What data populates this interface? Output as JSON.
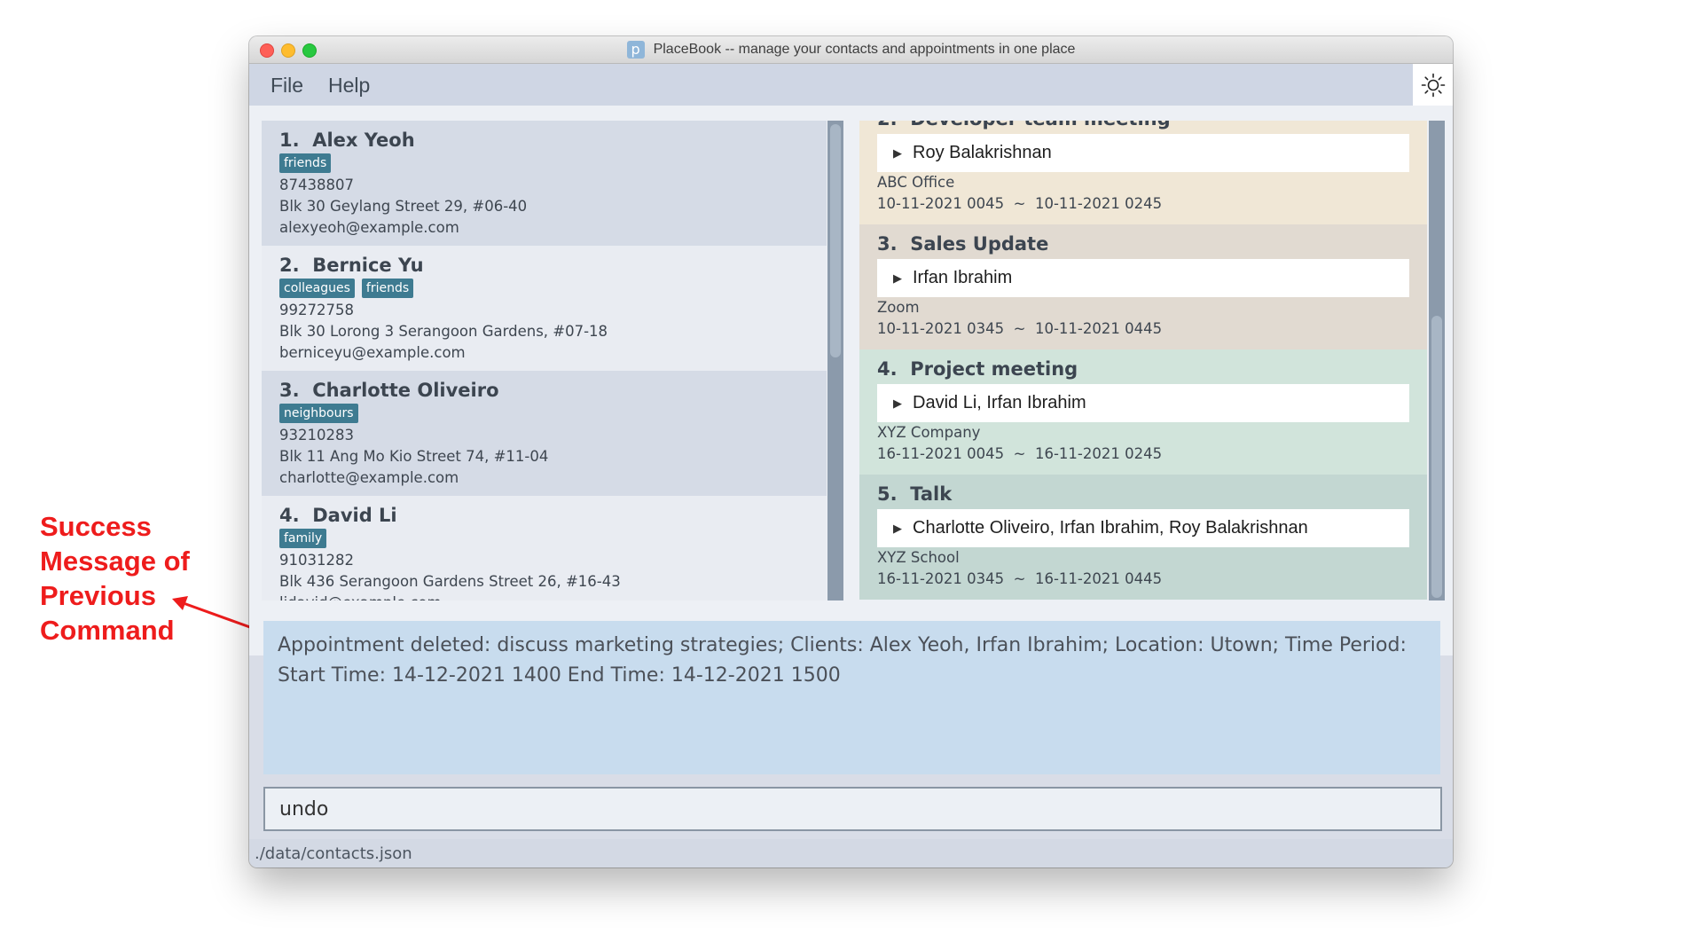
{
  "annotation": {
    "lines": [
      "Success",
      "Message of",
      "Previous",
      "Command"
    ],
    "color": "#ee1c1c"
  },
  "window": {
    "title": "PlaceBook -- manage your contacts and appointments in one place",
    "app_icon_letter": "p"
  },
  "menu": {
    "file_label": "File",
    "help_label": "Help",
    "theme_toggle_icon": "sun-icon"
  },
  "contacts": [
    {
      "index": "1.",
      "name": "Alex Yeoh",
      "tags": [
        "friends"
      ],
      "phone": "87438807",
      "address": "Blk 30 Geylang Street 29, #06-40",
      "email": "alexyeoh@example.com"
    },
    {
      "index": "2.",
      "name": "Bernice Yu",
      "tags": [
        "colleagues",
        "friends"
      ],
      "phone": "99272758",
      "address": "Blk 30 Lorong 3 Serangoon Gardens, #07-18",
      "email": "berniceyu@example.com"
    },
    {
      "index": "3.",
      "name": "Charlotte Oliveiro",
      "tags": [
        "neighbours"
      ],
      "phone": "93210283",
      "address": "Blk 11 Ang Mo Kio Street 74, #11-04",
      "email": "charlotte@example.com"
    },
    {
      "index": "4.",
      "name": "David Li",
      "tags": [
        "family"
      ],
      "phone": "91031282",
      "address": "Blk 436 Serangoon Gardens Street 26, #16-43",
      "email": "lidavid@example.com"
    }
  ],
  "appointments": [
    {
      "index": "2.",
      "title": "Developer team meeting",
      "clients": "Roy Balakrishnan",
      "location": "ABC Office",
      "start": "10-11-2021 0045",
      "separator": "~",
      "end": "10-11-2021 0245",
      "color": "#f0e7d6"
    },
    {
      "index": "3.",
      "title": "Sales Update",
      "clients": "Irfan Ibrahim",
      "location": "Zoom",
      "start": "10-11-2021 0345",
      "separator": "~",
      "end": "10-11-2021 0445",
      "color": "#e1dad1"
    },
    {
      "index": "4.",
      "title": "Project meeting",
      "clients": "David Li, Irfan Ibrahim",
      "location": "XYZ Company",
      "start": "16-11-2021 0045",
      "separator": "~",
      "end": "16-11-2021 0245",
      "color": "#d1e4db"
    },
    {
      "index": "5.",
      "title": "Talk",
      "clients": "Charlotte Oliveiro, Irfan Ibrahim, Roy Balakrishnan",
      "location": "XYZ School",
      "start": "16-11-2021 0345",
      "separator": "~",
      "end": "16-11-2021 0445",
      "color": "#c3d7d2"
    }
  ],
  "result": {
    "message": "Appointment deleted: discuss marketing strategies; Clients: Alex Yeoh, Irfan Ibrahim; Location: Utown; Time Period: Start Time: 14-12-2021 1400 End Time: 14-12-2021 1500"
  },
  "command": {
    "value": "undo"
  },
  "status": {
    "file_path": "./data/contacts.json"
  },
  "colors": {
    "tag_bg": "#3e7b91",
    "result_bg": "#c8dcee",
    "menubar_bg": "#cfd6e4"
  }
}
